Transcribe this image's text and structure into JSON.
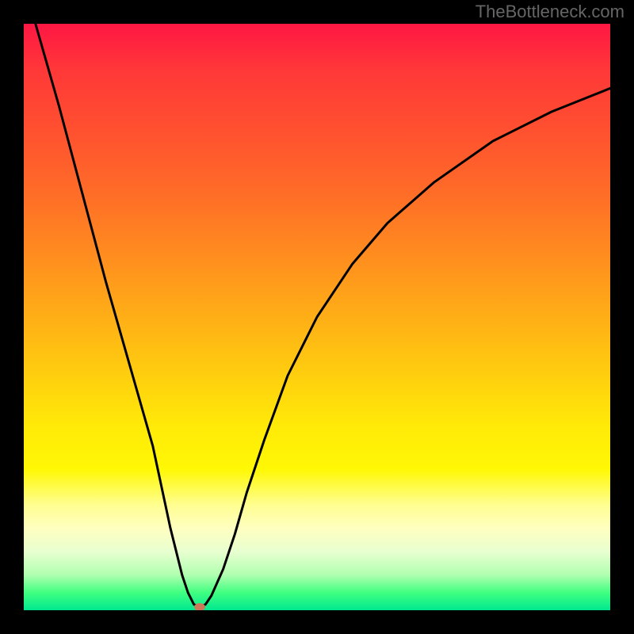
{
  "watermark": "TheBottleneck.com",
  "chart_data": {
    "type": "line",
    "title": "",
    "xlabel": "",
    "ylabel": "",
    "xlim": [
      0,
      100
    ],
    "ylim": [
      0,
      100
    ],
    "series": [
      {
        "name": "curve",
        "x": [
          2,
          6,
          10,
          14,
          18,
          22,
          25,
          27,
          28,
          29,
          30,
          31,
          32,
          34,
          36,
          38,
          41,
          45,
          50,
          56,
          62,
          70,
          80,
          90,
          100
        ],
        "y": [
          100,
          86,
          71,
          56,
          42,
          28,
          14,
          6,
          3,
          1,
          0.5,
          1,
          2.5,
          7,
          13,
          20,
          29,
          40,
          50,
          59,
          66,
          73,
          80,
          85,
          89
        ]
      }
    ],
    "marker": {
      "x": 30,
      "y": 0.5,
      "color": "#c97a5a"
    },
    "background_gradient": {
      "top": "#ff1744",
      "middle": "#ffe808",
      "bottom": "#00e890"
    }
  }
}
